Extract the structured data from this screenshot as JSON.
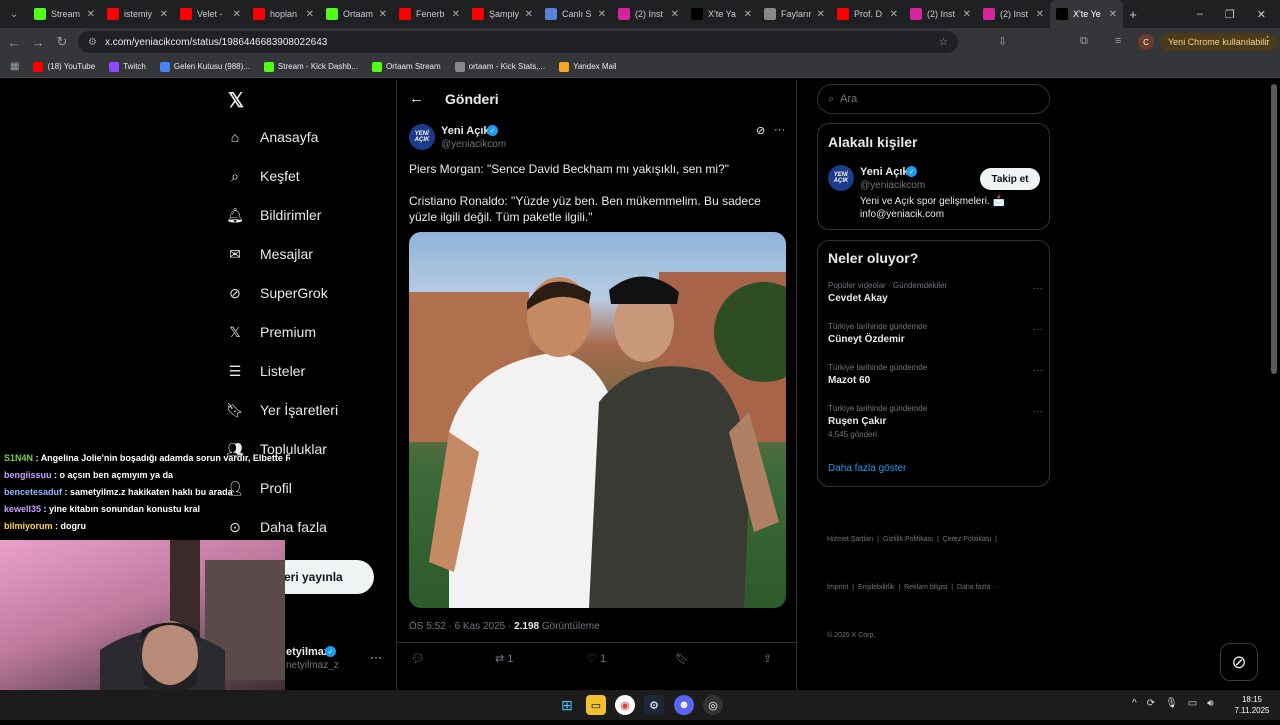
{
  "browser": {
    "tabs": [
      {
        "label": "Stream",
        "color": "#53fc18",
        "icon": "kick-icon"
      },
      {
        "label": "istemiy",
        "color": "#ff0000",
        "icon": "youtube-icon"
      },
      {
        "label": "Velet -",
        "color": "#ff0000",
        "icon": "youtube-icon"
      },
      {
        "label": "hoplan",
        "color": "#ff0000",
        "icon": "youtube-icon"
      },
      {
        "label": "Ortaam",
        "color": "#53fc18",
        "icon": "kick-icon"
      },
      {
        "label": "Fenerb",
        "color": "#ff0000",
        "icon": "youtube-icon"
      },
      {
        "label": "Şampiy",
        "color": "#ff0000",
        "icon": "youtube-icon"
      },
      {
        "label": "Canlı S",
        "color": "#5a7fd6",
        "icon": "m-icon"
      },
      {
        "label": "(2) Inst",
        "color": "#d6249f",
        "icon": "instagram-icon"
      },
      {
        "label": "X'te Ya",
        "color": "#000000",
        "icon": "x-icon"
      },
      {
        "label": "Faylarır",
        "color": "#888888",
        "icon": "globe-icon"
      },
      {
        "label": "Prof. D",
        "color": "#ff0000",
        "icon": "youtube-icon"
      },
      {
        "label": "(2) Inst",
        "color": "#d6249f",
        "icon": "instagram-icon"
      },
      {
        "label": "(2) Inst",
        "color": "#d6249f",
        "icon": "instagram-icon"
      },
      {
        "label": "X'te Ye",
        "color": "#000000",
        "icon": "x-icon"
      }
    ],
    "url": "x.com/yeniacikcom/status/1986446683908022643",
    "update_label": "Yeni Chrome kullanılabilir",
    "profile_initial": "C",
    "bookmarks": [
      {
        "label": "(18) YouTube",
        "color": "#ff0000"
      },
      {
        "label": "Twitch",
        "color": "#9146ff"
      },
      {
        "label": "Gelen Kutusu (988)...",
        "color": "#4285f4"
      },
      {
        "label": "Stream - Kick Dashb...",
        "color": "#53fc18"
      },
      {
        "label": "Ortaam Stream",
        "color": "#53fc18"
      },
      {
        "label": "ortaam - Kick Stats,...",
        "color": "#888888"
      },
      {
        "label": "Yandex Mail",
        "color": "#f5a623"
      }
    ]
  },
  "nav": {
    "items": [
      {
        "label": "Anasayfa",
        "icon": "home-icon"
      },
      {
        "label": "Keşfet",
        "icon": "search-icon"
      },
      {
        "label": "Bildirimler",
        "icon": "bell-icon"
      },
      {
        "label": "Mesajlar",
        "icon": "mail-icon"
      },
      {
        "label": "SuperGrok",
        "icon": "grok-icon"
      },
      {
        "label": "Premium",
        "icon": "x-logo-icon"
      },
      {
        "label": "Listeler",
        "icon": "list-icon"
      },
      {
        "label": "Yer İşaretleri",
        "icon": "bookmark-icon"
      },
      {
        "label": "Topluluklar",
        "icon": "people-icon"
      },
      {
        "label": "Profil",
        "icon": "person-icon"
      },
      {
        "label": "Daha fazla",
        "icon": "more-circle-icon"
      }
    ],
    "post_button": "eri yayınla",
    "account_name": "etyilmaz",
    "account_handle": "netyilmaz_z"
  },
  "post": {
    "header": "Gönderi",
    "author": "Yeni Açık",
    "handle": "@yeniacikcom",
    "text1": "Piers Morgan: \"Sence David Beckham mı yakışıklı, sen mi?\"",
    "text2": "Cristiano Ronaldo: \"Yüzde yüz ben. Ben mükemmelim. Bu sadece yüzle ilgili değil. Tüm paketle ilgili.\"",
    "time": "ÖS 5:52 · 6 Kas 2025 · ",
    "views": "2.198",
    "views_label": "Görüntüleme",
    "retweets": "1",
    "likes": "1"
  },
  "right": {
    "search_placeholder": "Ara",
    "people_title": "Alakalı kişiler",
    "person_name": "Yeni Açık",
    "person_handle": "@yeniacikcom",
    "follow": "Takip et",
    "bio": "Yeni ve Açık spor gelişmeleri. 📩 info@yeniacik.com",
    "trends_title": "Neler oluyor?",
    "trends": [
      {
        "ctx": "Popüler videolar · Gündemdekiler",
        "name": "Cevdet Akay",
        "count": ""
      },
      {
        "ctx": "Türkiye tarihinde gündemde",
        "name": "Cüneyt Özdemir",
        "count": ""
      },
      {
        "ctx": "Türkiye tarihinde gündemde",
        "name": "Mazot 60",
        "count": ""
      },
      {
        "ctx": "Türkiye tarihinde gündemde",
        "name": "Ruşen Çakır",
        "count": "4.545 gönderi"
      }
    ],
    "show_more": "Daha fazla göster",
    "footer1": "Hizmet Şartları  |  Gizlilik Politikası  |  Çerez Politikası  |",
    "footer2": "İmprint  |  Erişilebilirlik  |  Reklam bilgisi  |  Daha fazla ···",
    "footer3": "© 2025 X Corp."
  },
  "chat": [
    {
      "user": "S1N4N",
      "msg": "Angelina Jolie'nin boşadığı adamda sorun vardır, Elbette Ronaldo",
      "color": "#7bd148"
    },
    {
      "user": "bengiissuu",
      "msg": "o açsın ben açmıyım ya da",
      "color": "#c9a0ff"
    },
    {
      "user": "bencetesaduf",
      "msg": "sametyilmz.z hakikaten haklı bu arada",
      "color": "#8fb5ff"
    },
    {
      "user": "kewell35",
      "msg": "yine kitabın sonundan konustu kral",
      "color": "#c9a0ff"
    },
    {
      "user": "bilmiyorum",
      "msg": "dogru",
      "color": "#ffd24a"
    }
  ],
  "clock": {
    "time": "18:15",
    "date": "7.11.2025"
  }
}
